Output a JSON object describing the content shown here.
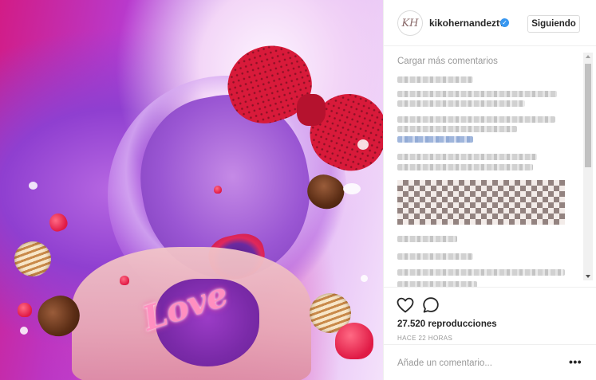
{
  "post": {
    "author_initials": "KH",
    "username": "kikohernandeztv",
    "verified_mark": "✓",
    "follow_label": "Siguiendo",
    "load_more": "Cargar más comentarios",
    "views": "27.520 reproducciones",
    "time": "HACE 22 HORAS",
    "comment_placeholder": "Añade un comentario...",
    "more_label": "•••"
  },
  "media": {
    "sticker_text": "Love",
    "type": "video"
  },
  "icons": {
    "like": "heart-outline-icon",
    "comment": "speech-bubble-icon",
    "more": "ellipsis-icon"
  },
  "colors": {
    "verified": "#3897f0",
    "muted": "#999999",
    "text": "#262626"
  }
}
